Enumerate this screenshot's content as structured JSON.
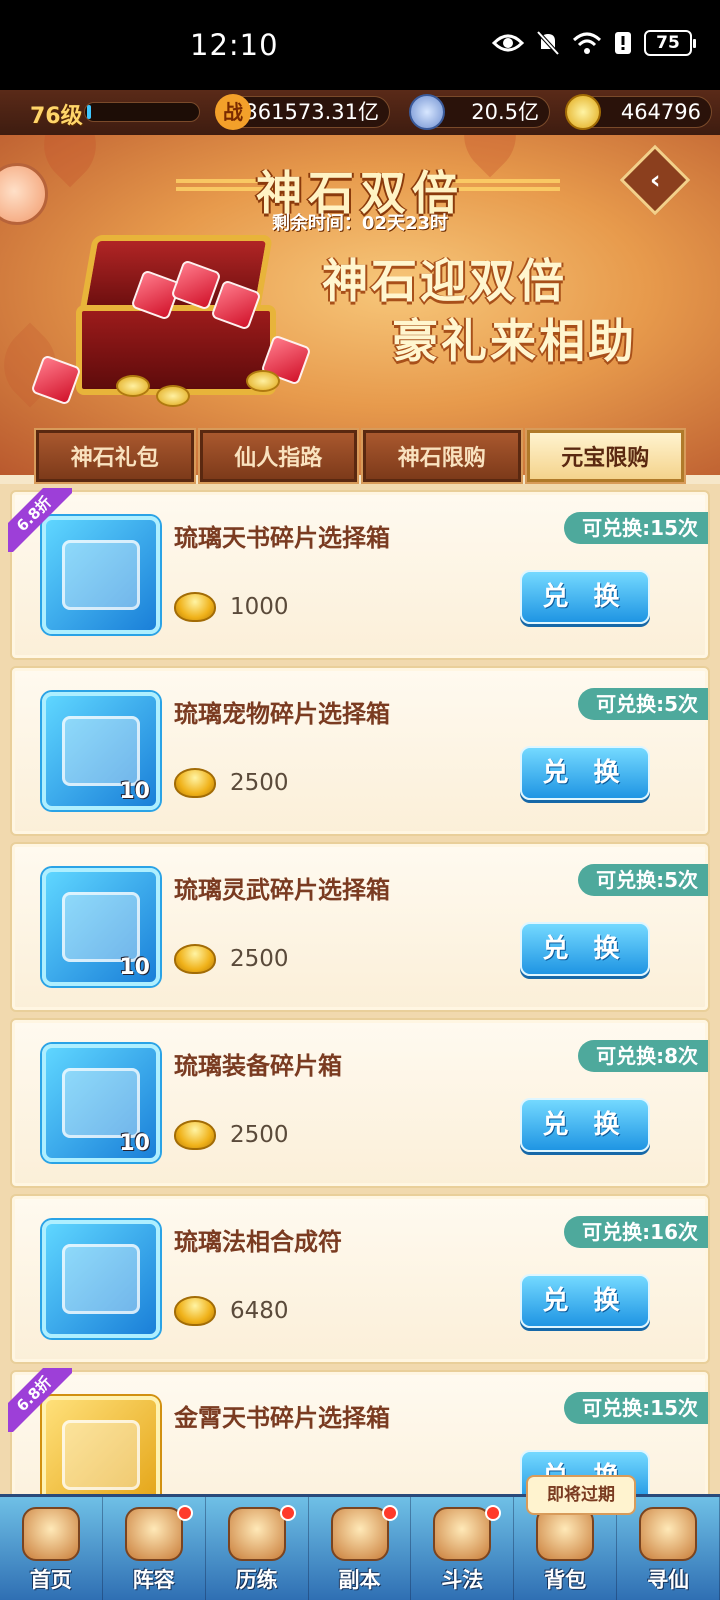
{
  "status_bar": {
    "time": "12:10",
    "battery": "75"
  },
  "resources": {
    "level": "76级",
    "xp_fraction": 0.02,
    "power_icon_text": "战",
    "power": "361573.31亿",
    "silver": "20.5亿",
    "gold": "464796"
  },
  "banner": {
    "title": "神石双倍",
    "remaining_time": "剩余时间：02天23时",
    "slogan_line1": "神石迎双倍",
    "slogan_line2": "豪礼来相助"
  },
  "tabs": [
    {
      "label": "神石礼包",
      "active": false
    },
    {
      "label": "仙人指路",
      "active": false
    },
    {
      "label": "神石限购",
      "active": false
    },
    {
      "label": "元宝限购",
      "active": true
    }
  ],
  "items": [
    {
      "name": "琉璃天书碎片选择箱",
      "price": "1000",
      "remaining": "可兑换:15次",
      "button": "兑 换",
      "discount": "6.8折",
      "qty": "",
      "icon": "blue-pouch-icon"
    },
    {
      "name": "琉璃宠物碎片选择箱",
      "price": "2500",
      "remaining": "可兑换:5次",
      "button": "兑 换",
      "discount": "",
      "qty": "10",
      "icon": "pet-chest-icon"
    },
    {
      "name": "琉璃灵武碎片选择箱",
      "price": "2500",
      "remaining": "可兑换:5次",
      "button": "兑 换",
      "discount": "",
      "qty": "10",
      "icon": "weapon-chest-icon"
    },
    {
      "name": "琉璃装备碎片箱",
      "price": "2500",
      "remaining": "可兑换:8次",
      "button": "兑 换",
      "discount": "",
      "qty": "10",
      "icon": "equipment-chest-icon"
    },
    {
      "name": "琉璃法相合成符",
      "price": "6480",
      "remaining": "可兑换:16次",
      "button": "兑 换",
      "discount": "",
      "qty": "",
      "icon": "talisman-icon"
    },
    {
      "name": "金霄天书碎片选择箱",
      "price": "",
      "remaining": "可兑换:15次",
      "button": "兑 换",
      "discount": "6.8折",
      "qty": "",
      "icon": "gold-pouch-icon"
    }
  ],
  "nav": [
    {
      "label": "首页",
      "icon": "home-icon",
      "dot": false
    },
    {
      "label": "阵容",
      "icon": "lineup-icon",
      "dot": true
    },
    {
      "label": "历练",
      "icon": "training-icon",
      "dot": true
    },
    {
      "label": "副本",
      "icon": "dungeon-icon",
      "dot": true
    },
    {
      "label": "斗法",
      "icon": "battle-icon",
      "dot": true
    },
    {
      "label": "背包",
      "icon": "bag-icon",
      "dot": false
    },
    {
      "label": "寻仙",
      "icon": "seek-immortal-icon",
      "dot": false
    }
  ],
  "tooltip": "即将过期"
}
